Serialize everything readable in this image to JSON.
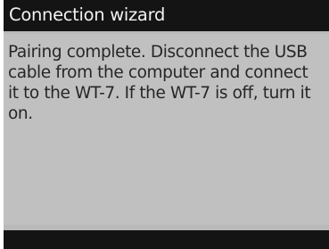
{
  "header": {
    "title": "Connection wizard"
  },
  "main": {
    "message": "Pairing complete. Disconnect the USB cable from the computer and connect it to the WT-7. If the WT-7 is off, turn it on."
  },
  "colors": {
    "title_bar": "#141414",
    "panel": "#c0c0c0",
    "title_text": "#f2f2f2",
    "body_text": "#262626"
  }
}
